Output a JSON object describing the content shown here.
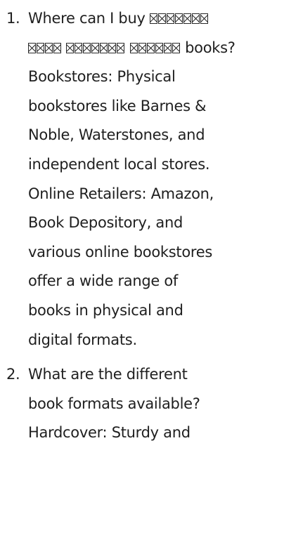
{
  "faq": [
    {
      "number": "1.",
      "lines": [
        {
          "text": "Where can I buy ",
          "tofu_after": [
            7
          ]
        },
        {
          "text": "",
          "tofu_before": [
            4,
            7,
            6
          ],
          "tail": " books?"
        },
        {
          "text": "Bookstores: Physical"
        },
        {
          "text": "bookstores like Barnes &"
        },
        {
          "text": "Noble, Waterstones, and"
        },
        {
          "text": "independent local stores."
        },
        {
          "text": "Online Retailers: Amazon,"
        },
        {
          "text": "Book Depository, and"
        },
        {
          "text": "various online bookstores"
        },
        {
          "text": "offer a wide range of"
        },
        {
          "text": "books in physical and"
        },
        {
          "text": "digital formats."
        }
      ]
    },
    {
      "number": "2.",
      "lines": [
        {
          "text": "What are the different"
        },
        {
          "text": "book formats available?"
        },
        {
          "text": "Hardcover: Sturdy and"
        }
      ]
    }
  ]
}
